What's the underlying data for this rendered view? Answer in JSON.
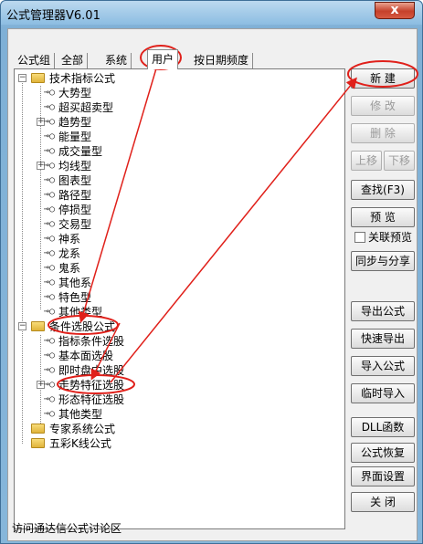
{
  "window": {
    "title": "公式管理器V6.01",
    "close_label": "x"
  },
  "tabs": [
    {
      "label": "公式组",
      "active": false
    },
    {
      "label": "全部",
      "active": false
    },
    {
      "label": "系统",
      "active": false
    },
    {
      "label": "用户",
      "active": true
    },
    {
      "label": "按日期频度",
      "active": false
    }
  ],
  "tree": {
    "group1": {
      "label": "技术指标公式",
      "children": [
        "大势型",
        "超买超卖型",
        "趋势型",
        "能量型",
        "成交量型",
        "均线型",
        "图表型",
        "路径型",
        "停损型",
        "交易型",
        "神系",
        "龙系",
        "鬼系",
        "其他系",
        "特色型",
        "其他类型"
      ]
    },
    "group2": {
      "label": "条件选股公式",
      "children": [
        "指标条件选股",
        "基本面选股",
        "即时盘中选股",
        "走势特征选股",
        "形态特征选股",
        "其他类型"
      ]
    },
    "group3": {
      "label": "专家系统公式"
    },
    "group4": {
      "label": "五彩K线公式"
    }
  },
  "buttons": {
    "new": "新  建",
    "edit": "修  改",
    "delete": "删  除",
    "move_up": "上移",
    "move_down": "下移",
    "find": "查找(F3)",
    "preview": "预  览",
    "link_preview": "关联预览",
    "sync_share": "同步与分享",
    "export": "导出公式",
    "quick_export": "快速导出",
    "import": "导入公式",
    "temp_import": "临时导入",
    "dll": "DLL函数",
    "restore": "公式恢复",
    "ui_settings": "界面设置",
    "close": "关  闭"
  },
  "status_text": "访问通达信公式讨论区",
  "annotation_color": "#e0201a"
}
